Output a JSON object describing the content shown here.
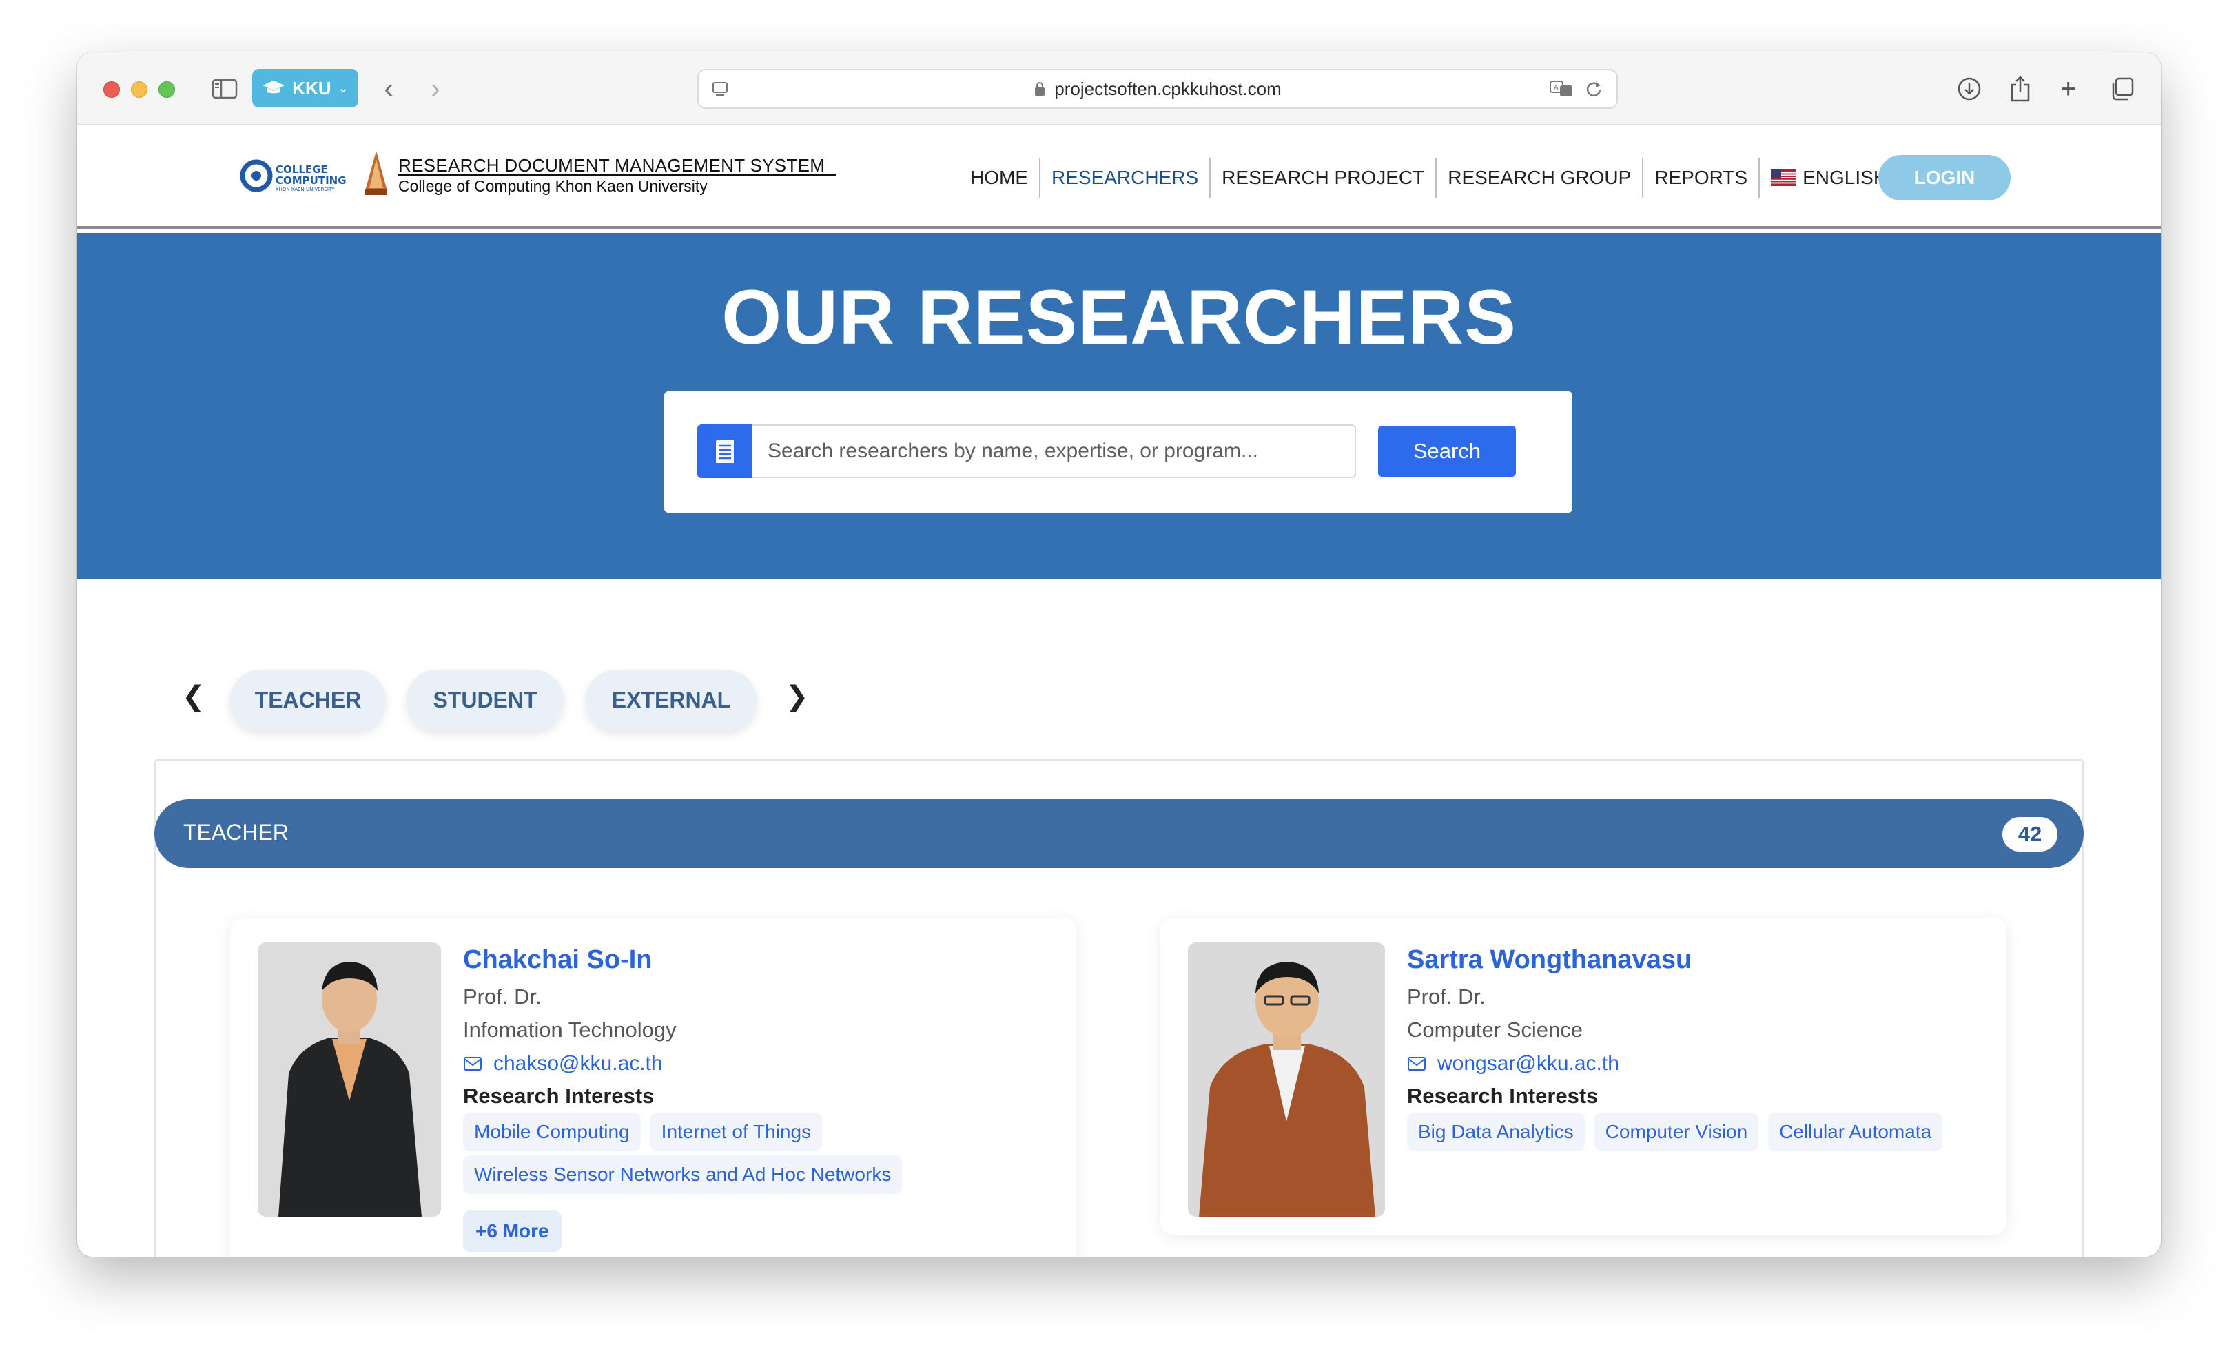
{
  "browser": {
    "tab_label": "KKU",
    "url": "projectsoften.cpkkuhost.com"
  },
  "site": {
    "logo_text": "COLLEGE OF COMPUTING",
    "title": "RESEARCH DOCUMENT MANAGEMENT SYSTEM",
    "subtitle": "College of Computing Khon Kaen University",
    "nav": [
      {
        "label": "HOME"
      },
      {
        "label": "RESEARCHERS"
      },
      {
        "label": "RESEARCH PROJECT"
      },
      {
        "label": "RESEARCH GROUP"
      },
      {
        "label": "REPORTS"
      }
    ],
    "language": "ENGLISH",
    "login_label": "LOGIN"
  },
  "hero": {
    "title": "OUR RESEARCHERS",
    "search_placeholder": "Search researchers by name, expertise, or program...",
    "search_button": "Search"
  },
  "categories": {
    "prev_glyph": "❮",
    "next_glyph": "❯",
    "items": [
      {
        "label": "TEACHER"
      },
      {
        "label": "STUDENT"
      },
      {
        "label": "EXTERNAL"
      }
    ]
  },
  "group": {
    "title": "TEACHER",
    "count": "42"
  },
  "researchers": [
    {
      "name": "Chakchai So-In",
      "title": "Prof. Dr.",
      "department": "Infomation Technology",
      "email": "chakso@kku.ac.th",
      "interests_label": "Research Interests",
      "interests": [
        "Mobile Computing",
        "Internet of Things",
        "Wireless Sensor Networks and Ad Hoc Networks"
      ],
      "more_label": "+6 More"
    },
    {
      "name": "Sartra Wongthanavasu",
      "title": "Prof. Dr.",
      "department": "Computer Science",
      "email": "wongsar@kku.ac.th",
      "interests_label": "Research Interests",
      "interests": [
        "Big Data Analytics",
        "Computer Vision",
        "Cellular Automata"
      ]
    }
  ],
  "colors": {
    "hero_bg": "#3371b3",
    "accent": "#2c6bec",
    "group_bar": "#3d6da3",
    "link": "#2b63d9"
  }
}
